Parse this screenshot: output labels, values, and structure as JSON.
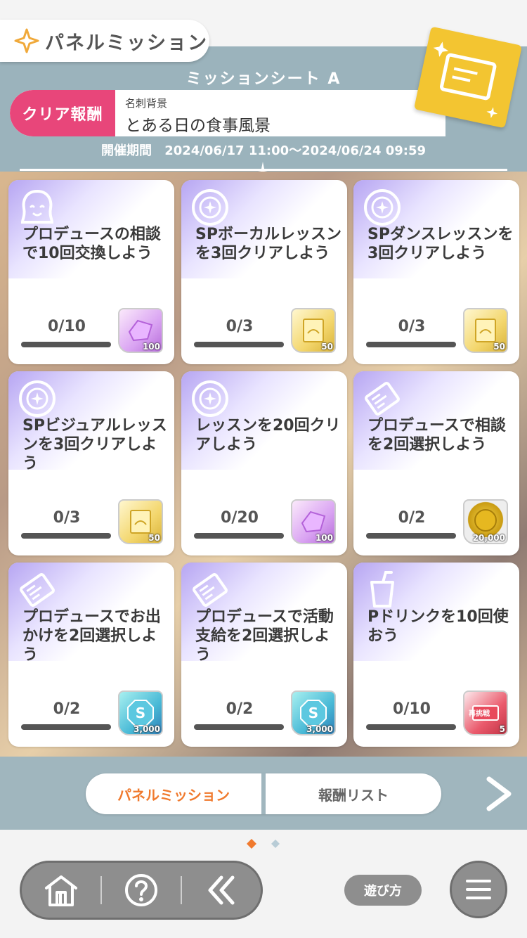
{
  "header": {
    "title": "パネルミッション",
    "sheet_title": "ミッションシート A",
    "reward_label": "クリア報酬",
    "reward_category": "名刺背景",
    "reward_name": "とある日の食事風景",
    "period_label": "開催期間",
    "period_value": "2024/06/17 11:00～2024/06/24 09:59"
  },
  "missions": [
    {
      "icon": "face-icon",
      "text": "プロデュースの相談で10回交換しよう",
      "progress": "0/10",
      "progress_fraction": 0,
      "reward_type": "crystal",
      "reward_qty": "100"
    },
    {
      "icon": "lesson-icon",
      "text": "SPボーカルレッスンを3回クリアしよう",
      "progress": "0/3",
      "progress_fraction": 0,
      "reward_type": "book",
      "reward_qty": "50"
    },
    {
      "icon": "lesson-icon",
      "text": "SPダンスレッスンを3回クリアしよう",
      "progress": "0/3",
      "progress_fraction": 0,
      "reward_type": "book",
      "reward_qty": "50"
    },
    {
      "icon": "lesson-icon",
      "text": "SPビジュアルレッスンを3回クリアしよう",
      "progress": "0/3",
      "progress_fraction": 0,
      "reward_type": "book",
      "reward_qty": "50"
    },
    {
      "icon": "lesson-icon",
      "text": "レッスンを20回クリアしよう",
      "progress": "0/20",
      "progress_fraction": 0,
      "reward_type": "crystal",
      "reward_qty": "100"
    },
    {
      "icon": "ticket-icon",
      "text": "プロデュースで相談を2回選択しよう",
      "progress": "0/2",
      "progress_fraction": 0,
      "reward_type": "coin",
      "reward_qty": "20,000"
    },
    {
      "icon": "ticket-icon",
      "text": "プロデュースでお出かけを2回選択しよう",
      "progress": "0/2",
      "progress_fraction": 0,
      "reward_type": "support",
      "reward_qty": "3,000"
    },
    {
      "icon": "ticket-icon",
      "text": "プロデュースで活動支給を2回選択しよう",
      "progress": "0/2",
      "progress_fraction": 0,
      "reward_type": "support",
      "reward_qty": "3,000"
    },
    {
      "icon": "drink-icon",
      "text": "Pドリンクを10回使おう",
      "progress": "0/10",
      "progress_fraction": 0,
      "reward_type": "ticket",
      "reward_qty": "5",
      "reward_label": "再挑戦"
    }
  ],
  "tabs": [
    {
      "label": "パネルミッション",
      "active": true
    },
    {
      "label": "報酬リスト",
      "active": false
    }
  ],
  "footer": {
    "howto_label": "遊び方"
  },
  "colors": {
    "accent_pink": "#e8467a",
    "accent_orange": "#f07a2e",
    "header_bg": "#9bb3bc",
    "card_purple": "#b8a8f0"
  }
}
